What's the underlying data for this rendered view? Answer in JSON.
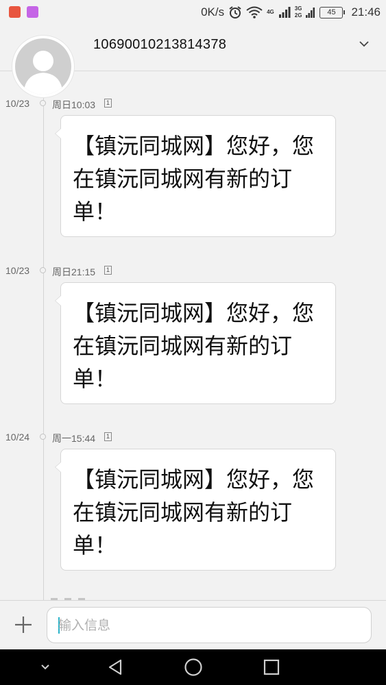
{
  "status_bar": {
    "net_speed": "0K/s",
    "net_4g": "4G",
    "net_3g": "3G",
    "net_2g": "2G",
    "battery": "45",
    "time": "21:46",
    "icons": [
      "alarm-icon",
      "wifi-icon",
      "signal-icon"
    ]
  },
  "header": {
    "title": "10690010213814378",
    "avatar_icon": "default-contact-avatar-icon",
    "expand_icon": "chevron-down-icon"
  },
  "messages": [
    {
      "date": "10/23",
      "time": "周日10:03",
      "sim": "1",
      "text": "【镇沅同城网】您好，您在镇沅同城网有新的订单！"
    },
    {
      "date": "10/23",
      "time": "周日21:15",
      "sim": "1",
      "text": "【镇沅同城网】您好，您在镇沅同城网有新的订单！"
    },
    {
      "date": "10/24",
      "time": "周一15:44",
      "sim": "1",
      "text": "【镇沅同城网】您好，您在镇沅同城网有新的订单！"
    }
  ],
  "composer": {
    "placeholder": "输入信息",
    "attach_icon": "plus-icon"
  },
  "nav_bar": {
    "icons": [
      "nav-hide-icon",
      "back-icon",
      "home-icon",
      "recents-icon"
    ]
  },
  "colors": {
    "background": "#f2f2f2",
    "bubble": "#ffffff",
    "cursor": "#2ab3c9"
  }
}
